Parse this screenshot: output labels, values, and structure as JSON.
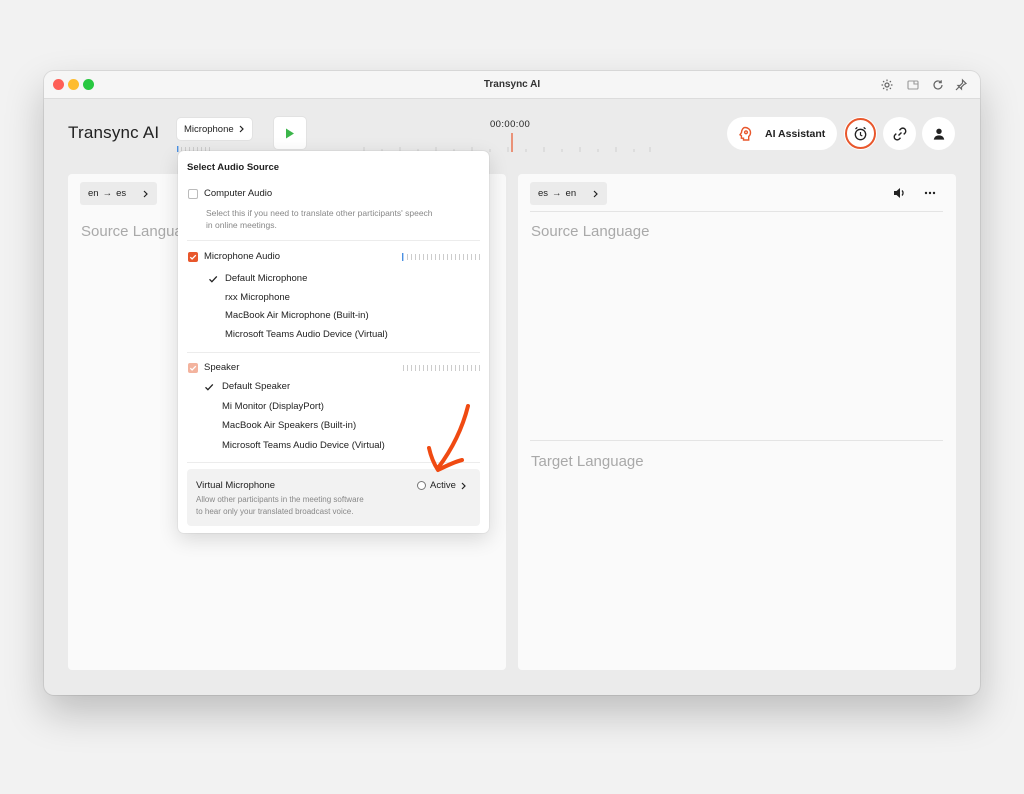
{
  "window": {
    "title": "Transync AI"
  },
  "header": {
    "app_title": "Transync AI",
    "mic_button_label": "Microphone",
    "timer": "00:00:00",
    "ai_assistant_label": "AI Assistant"
  },
  "left_panel": {
    "lang_pair": {
      "from": "en",
      "to": "es"
    },
    "placeholder": "Source Langua"
  },
  "right_panel": {
    "lang_pair": {
      "from": "es",
      "to": "en"
    },
    "source_placeholder": "Source Language",
    "target_placeholder": "Target Language"
  },
  "dropdown": {
    "title": "Select Audio Source",
    "computer_audio": {
      "label": "Computer Audio",
      "checked": false,
      "hint_line1": "Select this if you need to translate other participants' speech",
      "hint_line2": "in online meetings."
    },
    "microphone_audio": {
      "label": "Microphone Audio",
      "checked": true,
      "devices": [
        {
          "label": "Default Microphone",
          "selected": true
        },
        {
          "label": "rxx Microphone",
          "selected": false
        },
        {
          "label": "MacBook Air Microphone (Built-in)",
          "selected": false
        },
        {
          "label": "Microsoft Teams Audio Device (Virtual)",
          "selected": false
        }
      ]
    },
    "speaker": {
      "label": "Speaker",
      "checked": true,
      "devices": [
        {
          "label": "Default Speaker",
          "selected": true
        },
        {
          "label": "Mi Monitor (DisplayPort)",
          "selected": false
        },
        {
          "label": "MacBook Air Speakers (Built-in)",
          "selected": false
        },
        {
          "label": "Microsoft Teams Audio Device (Virtual)",
          "selected": false
        }
      ]
    },
    "virtual_microphone": {
      "title": "Virtual Microphone",
      "desc_line1": "Allow other participants in the meeting software",
      "desc_line2": "to hear only your translated broadcast voice.",
      "active_label": "Active",
      "active": false
    }
  },
  "colors": {
    "accent": "#e8572c",
    "accent_faded": "#f3b39e",
    "play_green": "#3bb54a",
    "level_blue": "#4a90e2",
    "annotation": "#f04a12"
  }
}
